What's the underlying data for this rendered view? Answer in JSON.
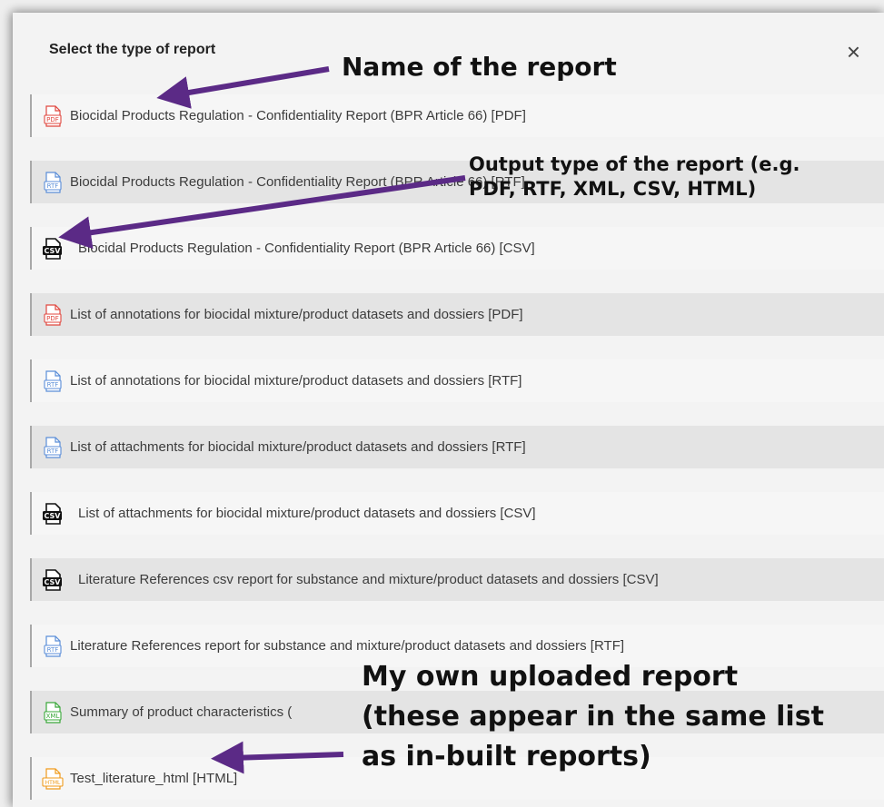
{
  "dialog": {
    "title": "Select the type of report",
    "close_icon": "close-icon",
    "close_glyph": "×"
  },
  "reports": [
    {
      "label": "Biocidal Products Regulation - Confidentiality Report (BPR Article 66) [PDF]",
      "format": "PDF",
      "icon": "pdf-file-icon",
      "color": "#e0473f"
    },
    {
      "label": "Biocidal Products Regulation - Confidentiality Report (BPR Article 66) [RTF]",
      "format": "RTF",
      "icon": "rtf-file-icon",
      "color": "#5b8ed8"
    },
    {
      "label": "Biocidal Products Regulation - Confidentiality Report (BPR Article 66) [CSV]",
      "format": "CSV",
      "icon": "csv-file-icon",
      "color": "#111111"
    },
    {
      "label": "List of annotations for biocidal mixture/product datasets and dossiers [PDF]",
      "format": "PDF",
      "icon": "pdf-file-icon",
      "color": "#e0473f"
    },
    {
      "label": "List of annotations for biocidal mixture/product datasets and dossiers [RTF]",
      "format": "RTF",
      "icon": "rtf-file-icon",
      "color": "#5b8ed8"
    },
    {
      "label": "List of attachments for biocidal mixture/product datasets and dossiers [RTF]",
      "format": "RTF",
      "icon": "rtf-file-icon",
      "color": "#5b8ed8"
    },
    {
      "label": "List of attachments for biocidal mixture/product datasets and dossiers [CSV]",
      "format": "CSV",
      "icon": "csv-file-icon",
      "color": "#111111"
    },
    {
      "label": "Literature References csv report for substance and mixture/product datasets and dossiers [CSV]",
      "format": "CSV",
      "icon": "csv-file-icon",
      "color": "#111111"
    },
    {
      "label": "Literature References report for substance and mixture/product datasets and dossiers [RTF]",
      "format": "RTF",
      "icon": "rtf-file-icon",
      "color": "#5b8ed8"
    },
    {
      "label": "Summary of product characteristics (",
      "format": "XML",
      "icon": "xml-file-icon",
      "color": "#3aa83a"
    },
    {
      "label": "Test_literature_html [HTML]",
      "format": "HTML",
      "icon": "html-file-icon",
      "color": "#ef9a1a"
    }
  ],
  "annotations": {
    "name_of_report": "Name of the report",
    "output_type_line1": "Output type of the report (e.g.",
    "output_type_line2": "PDF, RTF, XML, CSV, HTML)",
    "own_report_line1": "My own uploaded report",
    "own_report_line2": "(these appear in the same list",
    "own_report_line3": "as in-built reports)",
    "arrow_color": "#5b2a86"
  }
}
